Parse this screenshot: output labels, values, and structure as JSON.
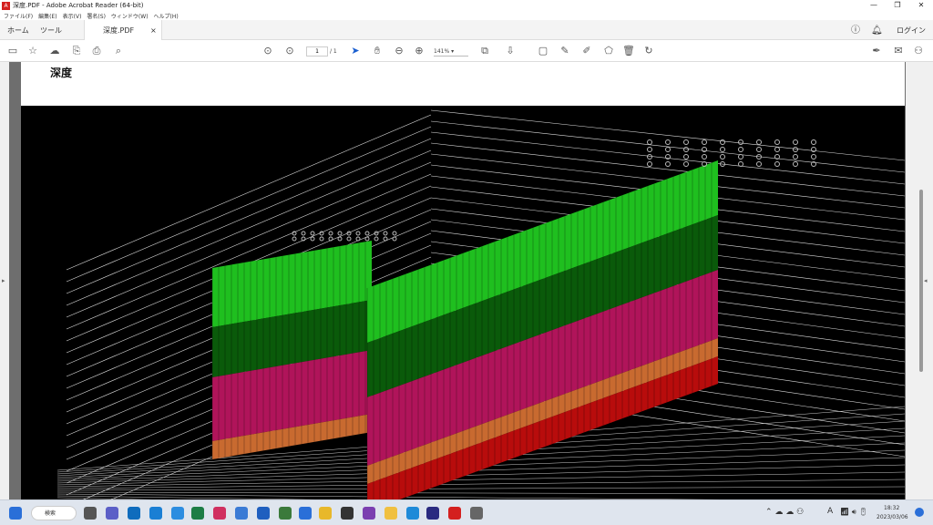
{
  "window": {
    "title": "深度.PDF - Adobe Acrobat Reader (64-bit)",
    "min": "—",
    "max": "❐",
    "close": "✕"
  },
  "menu": [
    "ファイル(F)",
    "編集(E)",
    "表示(V)",
    "署名(S)",
    "ウィンドウ(W)",
    "ヘルプ(H)"
  ],
  "tabs": {
    "home": "ホーム",
    "tools": "ツール",
    "doc": "深度.PDF",
    "doc_close": "×",
    "login": "ログイン"
  },
  "toolbar": {
    "page_current": "1",
    "page_total": "/ 1",
    "zoom": "141%"
  },
  "document": {
    "heading": "深度"
  },
  "plot": {
    "layer_colors": {
      "top": "#1fbf1f",
      "dark_green": "#0a5a0a",
      "magenta": "#b0145a",
      "orange": "#c86a30",
      "red": "#b80c0c"
    }
  },
  "taskbar": {
    "search": "検索",
    "time": "18:32",
    "date": "2023/03/06",
    "ime": "A"
  }
}
